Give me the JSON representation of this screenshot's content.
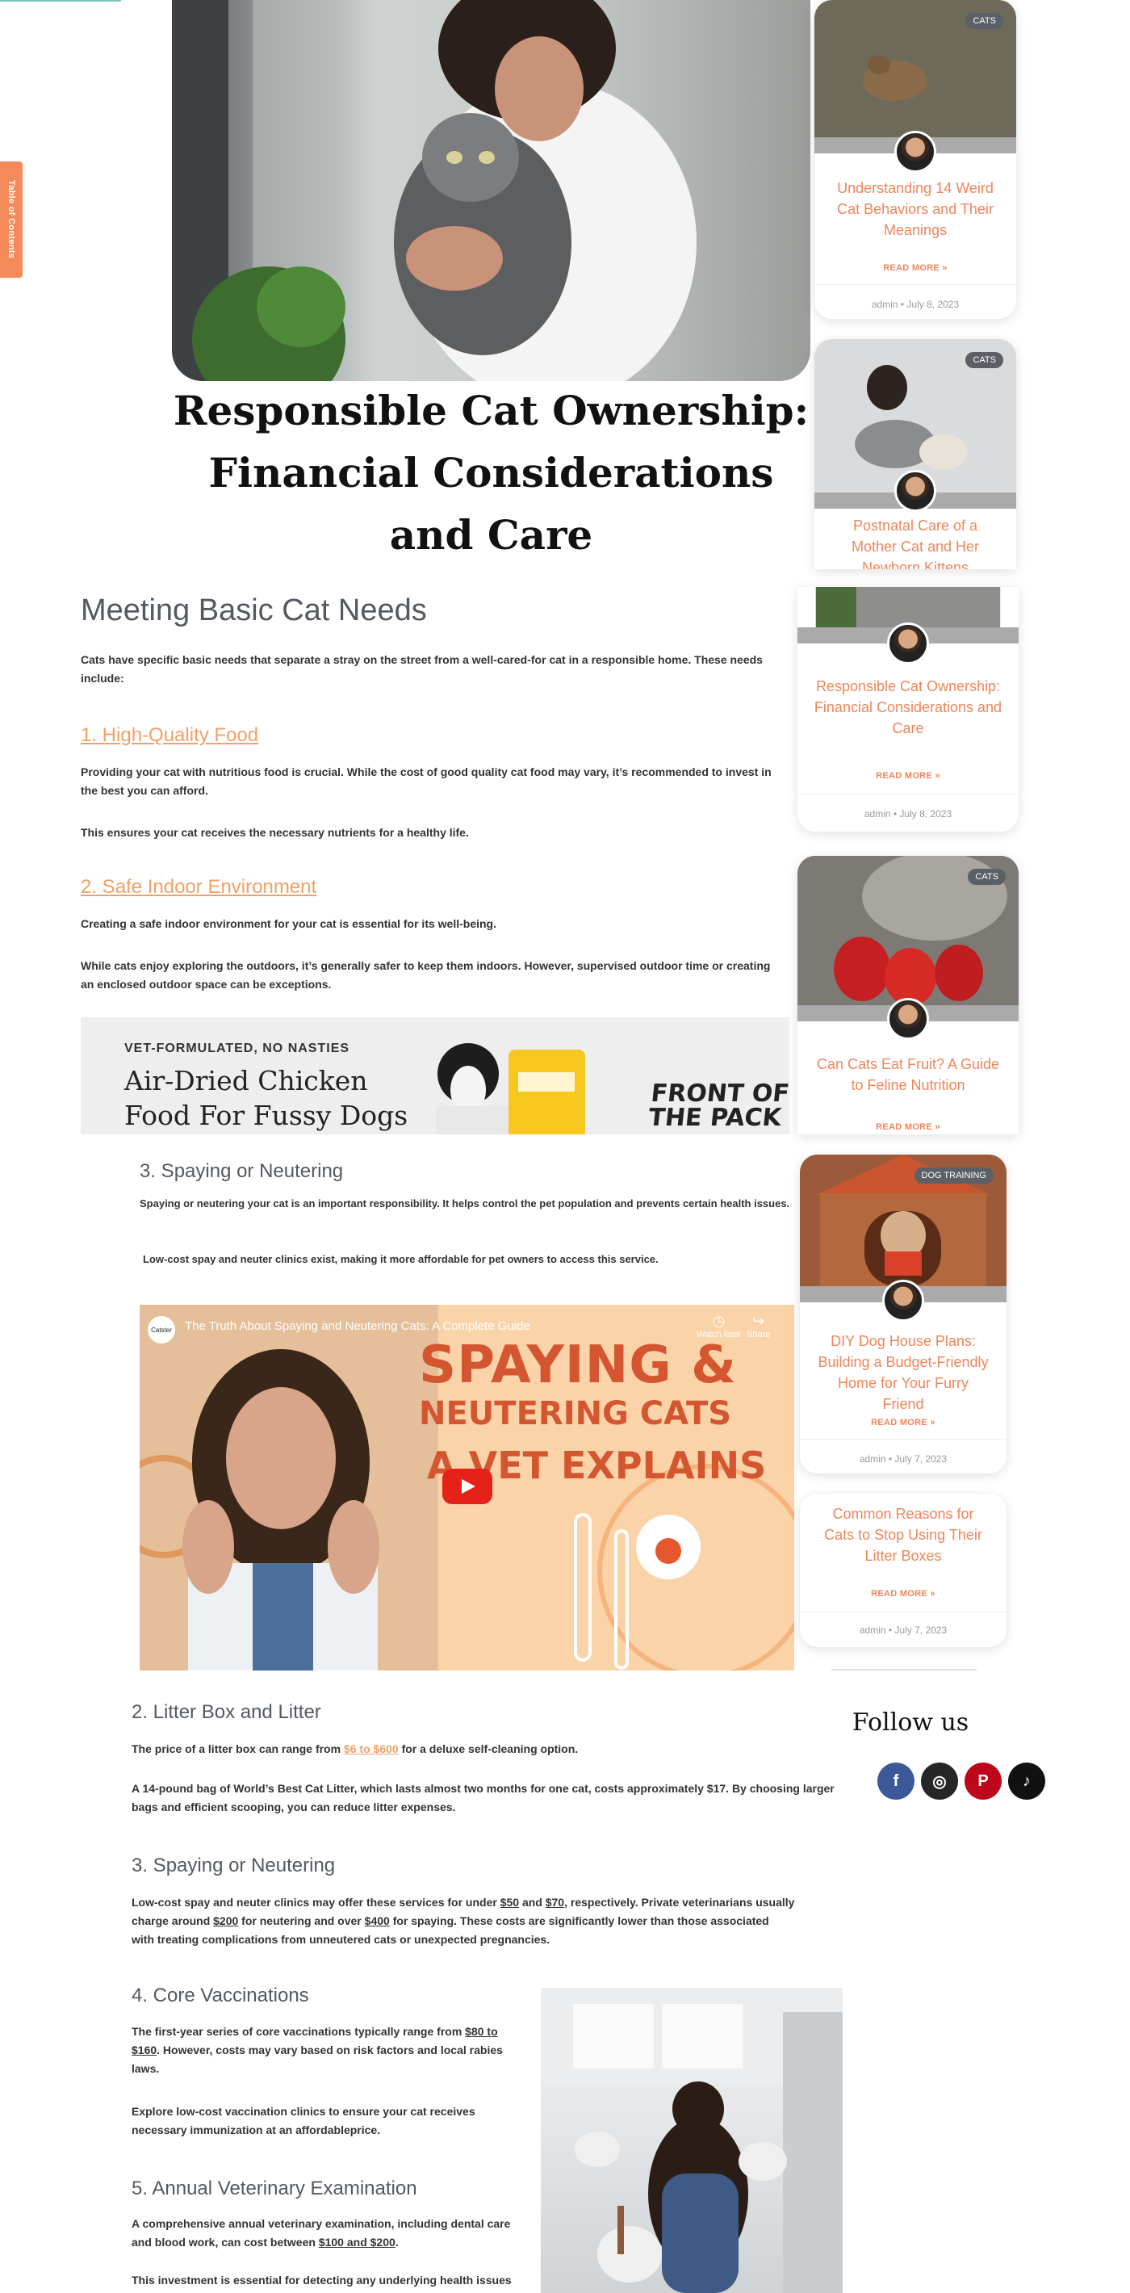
{
  "toc": {
    "label": "Table of Contents"
  },
  "article": {
    "title": "Responsible Cat Ownership: Financial Considerations and Care",
    "section_basic": {
      "heading": "Meeting Basic Cat Needs",
      "intro": "Cats have specific basic needs that separate a stray on the street from a well-cared-for cat in a responsible home. These needs include:"
    },
    "food": {
      "heading": "1. High-Quality Food",
      "p1": "Providing your cat with nutritious food is crucial. While the cost of good quality cat food may vary, it’s recommended to invest in the best you can afford.",
      "p2": "This ensures your cat receives the necessary nutrients for a healthy life."
    },
    "indoor": {
      "heading": "2. Safe Indoor Environment",
      "p1": "Creating a safe indoor environment for your cat is essential for its well-being.",
      "p2": "While cats enjoy exploring the outdoors, it’s generally safer to keep them indoors. However, supervised outdoor time or creating an enclosed outdoor space can be exceptions."
    },
    "ad": {
      "kicker": "VET-FORMULATED, NO NASTIES",
      "headline_1": "Air-Dried Chicken",
      "headline_2": "Food For Fussy Dogs",
      "brand_1": "FRONT OF",
      "brand_2": "THE PACK"
    },
    "spay_first": {
      "heading": "3. Spaying or Neutering",
      "p1": "Spaying or neutering your cat is an important responsibility. It helps control the pet population and prevents certain health issues.",
      "p2": "Low-cost spay and neuter clinics exist, making it more affordable for pet owners to access this service."
    },
    "video": {
      "channel": "Catster",
      "title": "The Truth About Spaying and Neutering Cats: A Complete Guide",
      "watch_later": "Watch later",
      "share": "Share",
      "overlay_1": "SPAYING &",
      "overlay_2": "NEUTERING CATS",
      "overlay_3": "A VET EXPLAINS"
    },
    "litter": {
      "heading": "2. Litter Box and Litter",
      "p1_a": "The price of a litter box can range from ",
      "p1_link1": "$6",
      "p1_mid": " to ",
      "p1_link2": "$600",
      "p1_b": " for a deluxe self-cleaning option.",
      "p2": "A 14-pound bag of World’s Best Cat Litter, which lasts almost two months for one cat, costs approximately $17. By choosing larger bags and efficient scooping, you can reduce litter expenses."
    },
    "spay_cost": {
      "heading": "3. Spaying or Neutering",
      "l1a": "Low-cost spay and neuter clinics may offer these services for under ",
      "v50": "$50",
      "and": " and ",
      "v70": "$70",
      "l1b": ", respectively. Private veterinarians usually",
      "l2a": "charge around ",
      "v200": "$200",
      "l2b": " for neutering and over ",
      "v400": "$400",
      "l2c": " for spaying. These costs are significantly lower than those associated",
      "l3": "with treating complications from unneutered cats or unexpected pregnancies."
    },
    "vacc": {
      "heading": "4. Core Vaccinations",
      "l1a": "The first-year series of core vaccinations typically range from ",
      "l1link": "$80 to",
      "l2link": "$160",
      "l2b": ". However, costs may vary based on risk factors and local rabies",
      "l3": "laws.",
      "p2a": "Explore low-cost vaccination clinics to ensure your cat receives",
      "p2b": "necessary immunization at an affordableprice."
    },
    "exam": {
      "heading": "5. Annual Veterinary Examination",
      "l1": "A comprehensive annual veterinary examination, including dental care",
      "l2a": "and blood work, can cost between ",
      "l2link": "$100 and $200",
      "l2b": ".",
      "p2": "This investment is essential for detecting any underlying health issues"
    }
  },
  "sidebar": {
    "posts": [
      {
        "badge": "CATS",
        "title": "Understanding 14 Weird Cat Behaviors and Their Meanings",
        "readmore": "READ MORE »",
        "author": "admin",
        "sep": "•",
        "date": "July 8, 2023"
      },
      {
        "badge": "CATS",
        "title": "Postnatal Care of a Mother Cat and Her Newborn Kittens"
      },
      {
        "title": "Responsible Cat Ownership: Financial Considerations and Care",
        "readmore": "READ MORE »",
        "author": "admin",
        "sep": "•",
        "date": "July 8, 2023"
      },
      {
        "badge": "CATS",
        "title": "Can Cats Eat Fruit? A Guide to Feline Nutrition",
        "readmore": "READ MORE »"
      },
      {
        "badge": "DOG TRAINING",
        "title": "DIY Dog House Plans: Building a Budget-Friendly Home for Your Furry Friend",
        "readmore": "READ MORE »",
        "author": "admin",
        "sep": "•",
        "date": "July 7, 2023"
      },
      {
        "title": "Common Reasons for Cats to Stop Using Their Litter Boxes",
        "readmore": "READ MORE »",
        "author": "admin",
        "sep": "•",
        "date": "July 7, 2023"
      }
    ],
    "follow": {
      "heading": "Follow us"
    }
  },
  "colors": {
    "accent": "#f0855a",
    "heading": "#54595f",
    "facebook": "#3b5998",
    "instagram": "#262626",
    "pinterest": "#bd081c",
    "tiktok": "#111111"
  },
  "icons": [
    "facebook-icon",
    "instagram-icon",
    "pinterest-icon",
    "tiktok-icon",
    "play-icon",
    "clock-icon",
    "share-icon"
  ]
}
